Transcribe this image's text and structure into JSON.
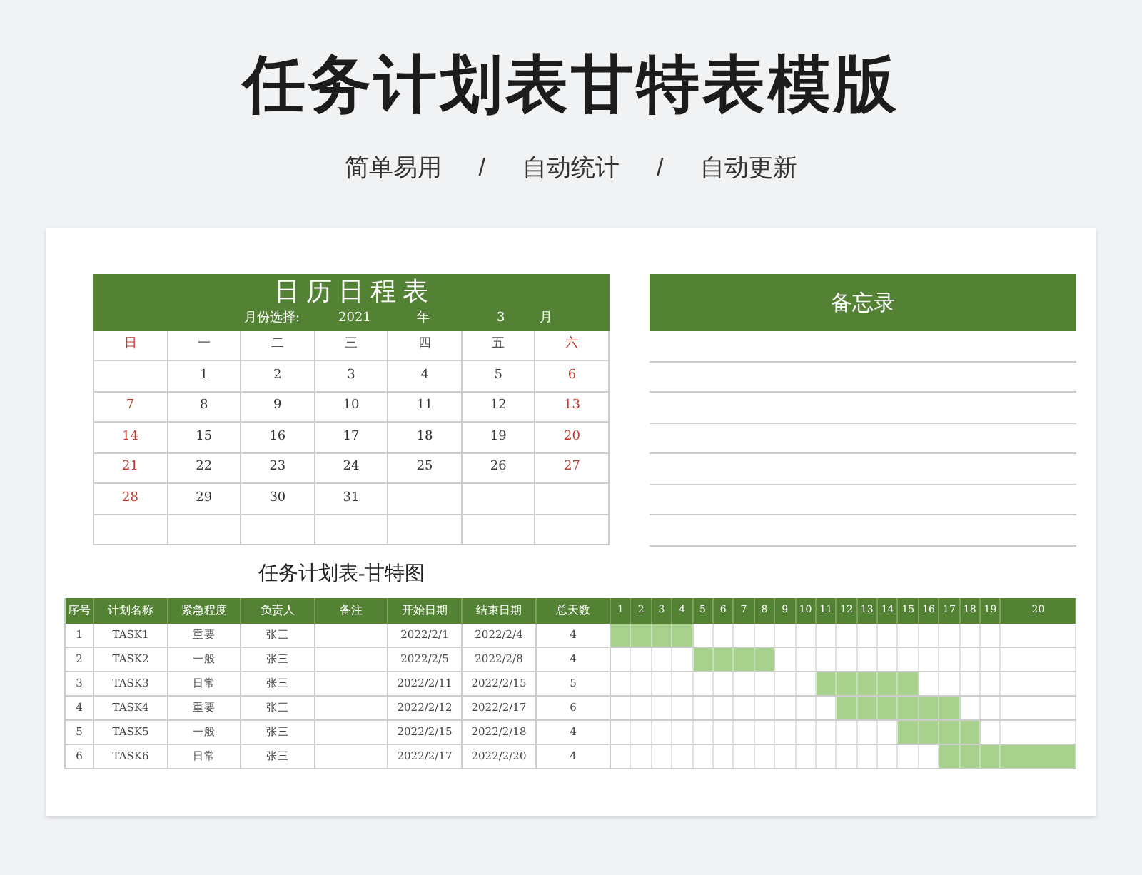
{
  "title": "任务计划表甘特表模版",
  "subtitle": [
    "简单易用",
    "/",
    "自动统计",
    "/",
    "自动更新"
  ],
  "calendar": {
    "title": "日 历 日 程 表",
    "month_label": "月份选择:",
    "year": "2021",
    "year_unit": "年",
    "month": "3",
    "month_unit": "月",
    "weekdays": [
      {
        "label": "日",
        "weekend": true
      },
      {
        "label": "一",
        "weekend": false
      },
      {
        "label": "二",
        "weekend": false
      },
      {
        "label": "三",
        "weekend": false
      },
      {
        "label": "四",
        "weekend": false
      },
      {
        "label": "五",
        "weekend": false
      },
      {
        "label": "六",
        "weekend": true
      }
    ],
    "weeks": [
      {
        "mon": "1",
        "tue": "2",
        "wed": "3",
        "thu": "4",
        "fri": "5",
        "sat": "6"
      },
      {
        "sun": "7",
        "mon": "8",
        "tue": "9",
        "wed": "10",
        "thu": "11",
        "fri": "12",
        "sat": "13"
      },
      {
        "sun": "14",
        "mon": "15",
        "tue": "16",
        "wed": "17",
        "thu": "18",
        "fri": "19",
        "sat": "20"
      },
      {
        "sun": "21",
        "mon": "22",
        "tue": "23",
        "wed": "24",
        "thu": "25",
        "fri": "26",
        "sat": "27"
      },
      {
        "sun": "28",
        "mon": "29",
        "tue": "30",
        "wed": "31"
      }
    ]
  },
  "memo": {
    "title": "备忘录"
  },
  "gantt": {
    "title": "任务计划表-甘特图",
    "columns": [
      "序号",
      "计划名称",
      "紧急程度",
      "负责人",
      "备注",
      "开始日期",
      "结束日期",
      "总天数"
    ],
    "days": [
      "1",
      "2",
      "3",
      "4",
      "5",
      "6",
      "7",
      "8",
      "9",
      "10",
      "11",
      "12",
      "13",
      "14",
      "15",
      "16",
      "17",
      "18",
      "19",
      "20"
    ],
    "rows": [
      {
        "no": "1",
        "name": "TASK1",
        "urgency": "重要",
        "owner": "张三",
        "start": "2022/2/1",
        "end": "2022/2/4",
        "total": "4",
        "filled": [
          true,
          true,
          true,
          true,
          false,
          false,
          false,
          false,
          false,
          false,
          false,
          false,
          false,
          false,
          false,
          false,
          false,
          false,
          false,
          false
        ]
      },
      {
        "no": "2",
        "name": "TASK2",
        "urgency": "一般",
        "owner": "张三",
        "start": "2022/2/5",
        "end": "2022/2/8",
        "total": "4",
        "filled": [
          false,
          false,
          false,
          false,
          true,
          true,
          true,
          true,
          false,
          false,
          false,
          false,
          false,
          false,
          false,
          false,
          false,
          false,
          false,
          false
        ]
      },
      {
        "no": "3",
        "name": "TASK3",
        "urgency": "日常",
        "owner": "张三",
        "start": "2022/2/11",
        "end": "2022/2/15",
        "total": "5",
        "filled": [
          false,
          false,
          false,
          false,
          false,
          false,
          false,
          false,
          false,
          false,
          true,
          true,
          true,
          true,
          true,
          false,
          false,
          false,
          false,
          false
        ]
      },
      {
        "no": "4",
        "name": "TASK4",
        "urgency": "重要",
        "owner": "张三",
        "start": "2022/2/12",
        "end": "2022/2/17",
        "total": "6",
        "filled": [
          false,
          false,
          false,
          false,
          false,
          false,
          false,
          false,
          false,
          false,
          false,
          true,
          true,
          true,
          true,
          true,
          true,
          false,
          false,
          false
        ]
      },
      {
        "no": "5",
        "name": "TASK5",
        "urgency": "一般",
        "owner": "张三",
        "start": "2022/2/15",
        "end": "2022/2/18",
        "total": "4",
        "filled": [
          false,
          false,
          false,
          false,
          false,
          false,
          false,
          false,
          false,
          false,
          false,
          false,
          false,
          false,
          true,
          true,
          true,
          true,
          false,
          false
        ]
      },
      {
        "no": "6",
        "name": "TASK6",
        "urgency": "日常",
        "owner": "张三",
        "start": "2022/2/17",
        "end": "2022/2/20",
        "total": "4",
        "filled": [
          false,
          false,
          false,
          false,
          false,
          false,
          false,
          false,
          false,
          false,
          false,
          false,
          false,
          false,
          false,
          false,
          true,
          true,
          true,
          true
        ]
      }
    ]
  }
}
